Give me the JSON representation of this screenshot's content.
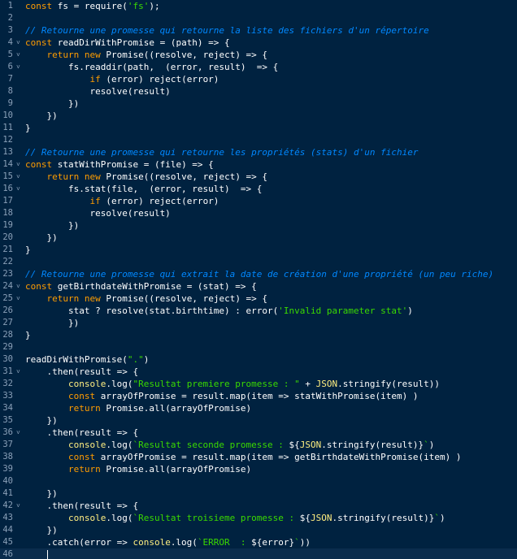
{
  "colors": {
    "background": "#002240",
    "keyword": "#ff9d00",
    "string": "#3ad900",
    "comment": "#0088ff",
    "constant": "#ff628c",
    "builtin": "#ffee80",
    "text": "#ffffff",
    "gutter": "#8aa0b8"
  },
  "editor": {
    "lines": [
      {
        "n": "1",
        "fold": "",
        "tokens": [
          [
            "key",
            "const"
          ],
          [
            "plain",
            " fs = require("
          ],
          [
            "str",
            "'fs'"
          ],
          [
            "plain",
            ");"
          ]
        ]
      },
      {
        "n": "2",
        "fold": "",
        "tokens": []
      },
      {
        "n": "3",
        "fold": "",
        "tokens": [
          [
            "com",
            "// Retourne une promesse qui retourne la liste des fichiers d'un répertoire"
          ]
        ]
      },
      {
        "n": "4",
        "fold": "v",
        "tokens": [
          [
            "key",
            "const"
          ],
          [
            "plain",
            " readDirWithPromise = (path) => {"
          ]
        ]
      },
      {
        "n": "5",
        "fold": "v",
        "tokens": [
          [
            "plain",
            "    "
          ],
          [
            "key",
            "return"
          ],
          [
            "plain",
            " "
          ],
          [
            "key",
            "new"
          ],
          [
            "plain",
            " Promise((resolve, reject) => {"
          ]
        ]
      },
      {
        "n": "6",
        "fold": "v",
        "tokens": [
          [
            "plain",
            "        fs.readdir(path,  (error, result)  => {"
          ]
        ]
      },
      {
        "n": "7",
        "fold": "",
        "tokens": [
          [
            "plain",
            "            "
          ],
          [
            "key",
            "if"
          ],
          [
            "plain",
            " (error) reject(error)"
          ]
        ]
      },
      {
        "n": "8",
        "fold": "",
        "tokens": [
          [
            "plain",
            "            resolve(result)"
          ]
        ]
      },
      {
        "n": "9",
        "fold": "",
        "tokens": [
          [
            "plain",
            "        })"
          ]
        ]
      },
      {
        "n": "10",
        "fold": "",
        "tokens": [
          [
            "plain",
            "    })"
          ]
        ]
      },
      {
        "n": "11",
        "fold": "",
        "tokens": [
          [
            "plain",
            "}"
          ]
        ]
      },
      {
        "n": "12",
        "fold": "",
        "tokens": []
      },
      {
        "n": "13",
        "fold": "",
        "tokens": [
          [
            "com",
            "// Retourne une promesse qui retourne les propriétés (stats) d'un fichier"
          ]
        ]
      },
      {
        "n": "14",
        "fold": "v",
        "tokens": [
          [
            "key",
            "const"
          ],
          [
            "plain",
            " statWithPromise = (file) => {"
          ]
        ]
      },
      {
        "n": "15",
        "fold": "v",
        "tokens": [
          [
            "plain",
            "    "
          ],
          [
            "key",
            "return"
          ],
          [
            "plain",
            " "
          ],
          [
            "key",
            "new"
          ],
          [
            "plain",
            " Promise((resolve, reject) => {"
          ]
        ]
      },
      {
        "n": "16",
        "fold": "v",
        "tokens": [
          [
            "plain",
            "        fs.stat(file,  (error, result)  => {"
          ]
        ]
      },
      {
        "n": "17",
        "fold": "",
        "tokens": [
          [
            "plain",
            "            "
          ],
          [
            "key",
            "if"
          ],
          [
            "plain",
            " (error) reject(error)"
          ]
        ]
      },
      {
        "n": "18",
        "fold": "",
        "tokens": [
          [
            "plain",
            "            resolve(result)"
          ]
        ]
      },
      {
        "n": "19",
        "fold": "",
        "tokens": [
          [
            "plain",
            "        })"
          ]
        ]
      },
      {
        "n": "20",
        "fold": "",
        "tokens": [
          [
            "plain",
            "    })"
          ]
        ]
      },
      {
        "n": "21",
        "fold": "",
        "tokens": [
          [
            "plain",
            "}"
          ]
        ]
      },
      {
        "n": "22",
        "fold": "",
        "tokens": []
      },
      {
        "n": "23",
        "fold": "",
        "tokens": [
          [
            "com",
            "// Retourne une promesse qui extrait la date de création d'une propriété (un peu riche)"
          ]
        ]
      },
      {
        "n": "24",
        "fold": "v",
        "tokens": [
          [
            "key",
            "const"
          ],
          [
            "plain",
            " getBirthdateWithPromise = (stat) => {"
          ]
        ]
      },
      {
        "n": "25",
        "fold": "v",
        "tokens": [
          [
            "plain",
            "    "
          ],
          [
            "key",
            "return"
          ],
          [
            "plain",
            " "
          ],
          [
            "key",
            "new"
          ],
          [
            "plain",
            " Promise((resolve, reject) => {"
          ]
        ]
      },
      {
        "n": "26",
        "fold": "",
        "tokens": [
          [
            "plain",
            "        stat ? resolve(stat.birthtime) : error("
          ],
          [
            "str",
            "'Invalid parameter stat'"
          ],
          [
            "plain",
            ")"
          ]
        ]
      },
      {
        "n": "27",
        "fold": "",
        "tokens": [
          [
            "plain",
            "        })"
          ]
        ]
      },
      {
        "n": "28",
        "fold": "",
        "tokens": [
          [
            "plain",
            "}"
          ]
        ]
      },
      {
        "n": "29",
        "fold": "",
        "tokens": []
      },
      {
        "n": "30",
        "fold": "",
        "tokens": [
          [
            "plain",
            "readDirWithPromise("
          ],
          [
            "str",
            "\".\""
          ],
          [
            "plain",
            ")"
          ]
        ]
      },
      {
        "n": "31",
        "fold": "v",
        "tokens": [
          [
            "plain",
            "    .then(result => {"
          ]
        ]
      },
      {
        "n": "32",
        "fold": "",
        "tokens": [
          [
            "plain",
            "        "
          ],
          [
            "obj",
            "console"
          ],
          [
            "plain",
            "."
          ],
          [
            "fn",
            "log"
          ],
          [
            "plain",
            "("
          ],
          [
            "str",
            "\"Resultat premiere promesse : \""
          ],
          [
            "plain",
            " + "
          ],
          [
            "obj",
            "JSON"
          ],
          [
            "plain",
            ".stringify(result))"
          ]
        ]
      },
      {
        "n": "33",
        "fold": "",
        "tokens": [
          [
            "plain",
            "        "
          ],
          [
            "key",
            "const"
          ],
          [
            "plain",
            " arrayOfPromise = result.map(item => statWithPromise(item) )"
          ]
        ]
      },
      {
        "n": "34",
        "fold": "",
        "tokens": [
          [
            "plain",
            "        "
          ],
          [
            "key",
            "return"
          ],
          [
            "plain",
            " Promise.all(arrayOfPromise)"
          ]
        ]
      },
      {
        "n": "35",
        "fold": "",
        "tokens": [
          [
            "plain",
            "    })"
          ]
        ]
      },
      {
        "n": "36",
        "fold": "v",
        "tokens": [
          [
            "plain",
            "    .then(result => {"
          ]
        ]
      },
      {
        "n": "37",
        "fold": "",
        "tokens": [
          [
            "plain",
            "        "
          ],
          [
            "obj",
            "console"
          ],
          [
            "plain",
            ".log("
          ],
          [
            "str",
            "`Resultat seconde promesse : "
          ],
          [
            "plain",
            "${"
          ],
          [
            "obj",
            "JSON"
          ],
          [
            "plain",
            ".stringify(result)}"
          ],
          [
            "str",
            "`"
          ],
          [
            "plain",
            ")"
          ]
        ]
      },
      {
        "n": "38",
        "fold": "",
        "tokens": [
          [
            "plain",
            "        "
          ],
          [
            "key",
            "const"
          ],
          [
            "plain",
            " arrayOfPromise = result.map(item => getBirthdateWithPromise(item) )"
          ]
        ]
      },
      {
        "n": "39",
        "fold": "",
        "tokens": [
          [
            "plain",
            "        "
          ],
          [
            "key",
            "return"
          ],
          [
            "plain",
            " Promise.all(arrayOfPromise)"
          ]
        ]
      },
      {
        "n": "40",
        "fold": "",
        "tokens": []
      },
      {
        "n": "41",
        "fold": "",
        "tokens": [
          [
            "plain",
            "    })"
          ]
        ]
      },
      {
        "n": "42",
        "fold": "v",
        "tokens": [
          [
            "plain",
            "    .then(result => {"
          ]
        ]
      },
      {
        "n": "43",
        "fold": "",
        "tokens": [
          [
            "plain",
            "        "
          ],
          [
            "obj",
            "console"
          ],
          [
            "plain",
            ".log("
          ],
          [
            "str",
            "`Resultat troisieme promesse : "
          ],
          [
            "plain",
            "${"
          ],
          [
            "obj",
            "JSON"
          ],
          [
            "plain",
            ".stringify(result)}"
          ],
          [
            "str",
            "`"
          ],
          [
            "plain",
            ")"
          ]
        ]
      },
      {
        "n": "44",
        "fold": "",
        "tokens": [
          [
            "plain",
            "    })"
          ]
        ]
      },
      {
        "n": "45",
        "fold": "",
        "tokens": [
          [
            "plain",
            "    .catch(error => "
          ],
          [
            "obj",
            "console"
          ],
          [
            "plain",
            ".log("
          ],
          [
            "str",
            "`ERROR  : "
          ],
          [
            "plain",
            "${error}"
          ],
          [
            "str",
            "`"
          ],
          [
            "plain",
            "))"
          ]
        ]
      },
      {
        "n": "46",
        "fold": "",
        "tokens": []
      }
    ]
  }
}
